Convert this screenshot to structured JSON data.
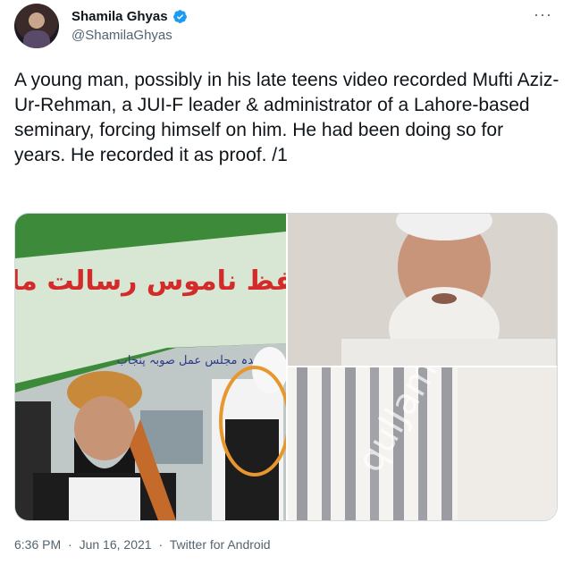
{
  "author": {
    "name": "Shamila Ghyas",
    "handle": "@ShamilaGhyas",
    "verified": true,
    "verified_color": "#1d9bf0"
  },
  "more_label": "···",
  "tweet": {
    "text": "A young man, possibly in his late teens video recorded Mufti Aziz-Ur-Rehman, a JUI-F leader & administrator of a Lahore-based seminary, forcing himself on him. He had been doing so for years. He recorded it as proof. /1"
  },
  "media": {
    "banner_text": "تحفظ ناموس رسالت ملین",
    "banner_subtext": "متحدہ مجلس عمل صوبہ پنجاب",
    "watermark": "qulJam",
    "highlight_color": "#e8962e"
  },
  "meta": {
    "time": "6:36 PM",
    "separator": "·",
    "date": "Jun 16, 2021",
    "source": "Twitter for Android"
  }
}
